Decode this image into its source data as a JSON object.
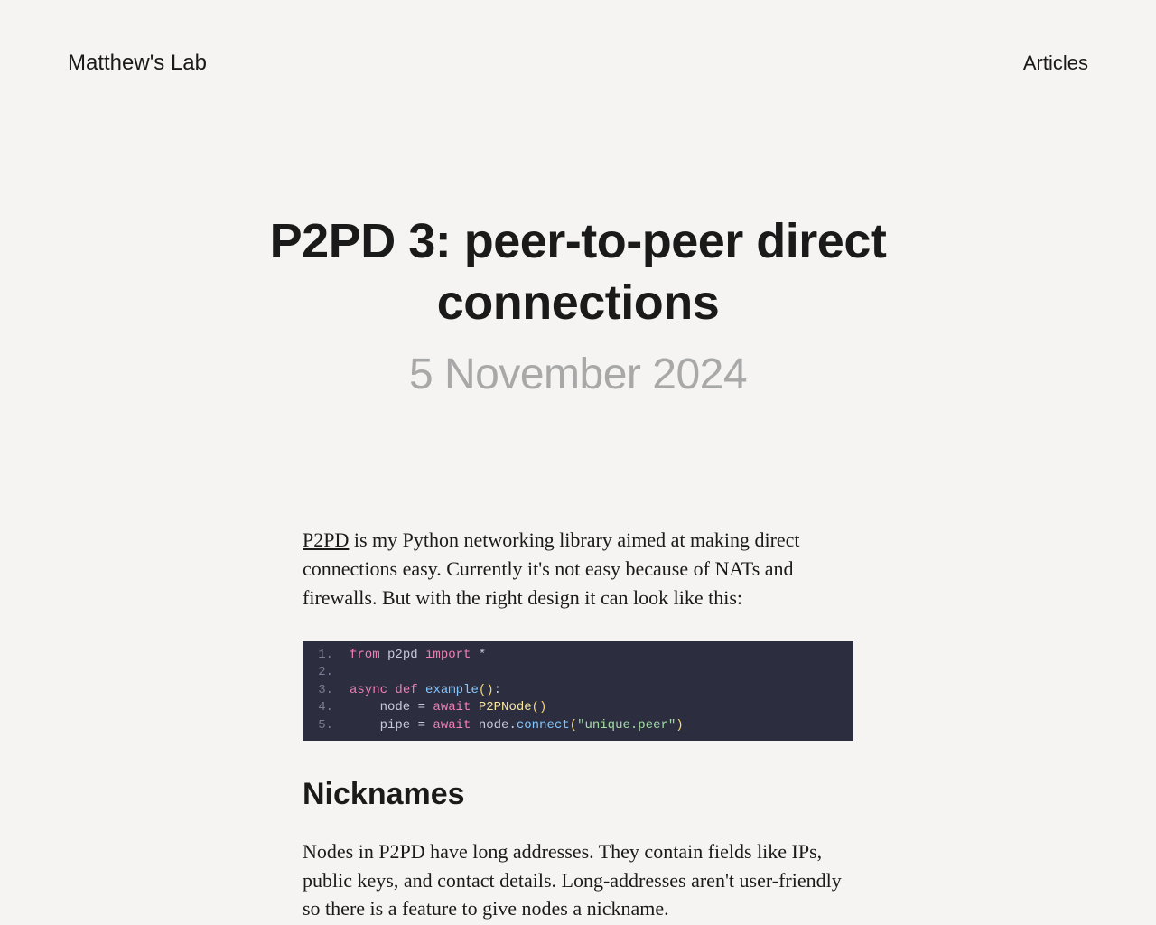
{
  "header": {
    "site_title": "Matthew's Lab",
    "nav_articles": "Articles"
  },
  "article": {
    "title": "P2PD 3: peer-to-peer direct connections",
    "date": "5 November 2024",
    "intro_link": "P2PD",
    "intro_rest": " is my Python networking library aimed at making direct connections easy. Currently it's not easy because of NATs and firewalls. But with the right design it can look like this:",
    "section1_title": "Nicknames",
    "section1_body": "Nodes in P2PD have long addresses. They contain fields like IPs, public keys, and contact details. Long-addresses aren't user-friendly so there is a feature to give nodes a nickname."
  },
  "code": {
    "lines": [
      {
        "n": "1.",
        "tokens": [
          [
            "kw",
            "from"
          ],
          [
            "",
            " p2pd "
          ],
          [
            "kw",
            "import"
          ],
          [
            "",
            " *"
          ]
        ]
      },
      {
        "n": "2.",
        "tokens": [
          [
            "",
            ""
          ]
        ]
      },
      {
        "n": "3.",
        "tokens": [
          [
            "kw",
            "async"
          ],
          [
            "",
            " "
          ],
          [
            "kw",
            "def"
          ],
          [
            "",
            " "
          ],
          [
            "fn",
            "example"
          ],
          [
            "punc",
            "()"
          ],
          [
            "",
            ":"
          ]
        ]
      },
      {
        "n": "4.",
        "tokens": [
          [
            "",
            "    node = "
          ],
          [
            "kw",
            "await"
          ],
          [
            "",
            " "
          ],
          [
            "cls",
            "P2PNode"
          ],
          [
            "punc",
            "()"
          ]
        ]
      },
      {
        "n": "5.",
        "tokens": [
          [
            "",
            "    pipe = "
          ],
          [
            "kw",
            "await"
          ],
          [
            "",
            " node."
          ],
          [
            "fn",
            "connect"
          ],
          [
            "punc",
            "("
          ],
          [
            "str",
            "\"unique.peer\""
          ],
          [
            "punc",
            ")"
          ]
        ]
      }
    ]
  }
}
